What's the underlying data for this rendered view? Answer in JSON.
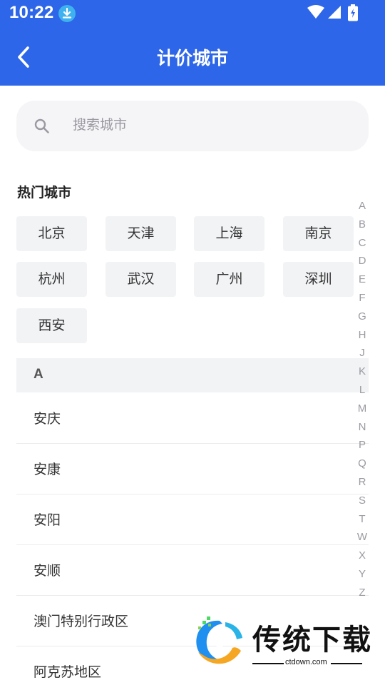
{
  "status_bar": {
    "time": "10:22",
    "icons": [
      "download-badge-icon",
      "wifi-icon",
      "cell-signal-icon",
      "battery-charging-icon"
    ]
  },
  "nav": {
    "title": "计价城市",
    "back_icon": "chevron-left-icon"
  },
  "search": {
    "placeholder": "搜索城市",
    "icon": "search-icon"
  },
  "hot_cities": {
    "title": "热门城市",
    "items": [
      "北京",
      "天津",
      "上海",
      "南京",
      "杭州",
      "武汉",
      "广州",
      "深圳",
      "西安"
    ]
  },
  "sections": [
    {
      "letter": "A",
      "cities": [
        "安庆",
        "安康",
        "安阳",
        "安顺",
        "澳门特别行政区",
        "阿克苏地区"
      ]
    }
  ],
  "alphabet_index": [
    "A",
    "B",
    "C",
    "D",
    "E",
    "F",
    "G",
    "H",
    "J",
    "K",
    "L",
    "M",
    "N",
    "P",
    "Q",
    "R",
    "S",
    "T",
    "W",
    "X",
    "Y",
    "Z"
  ],
  "watermark": {
    "text": "传统下载",
    "url": "ctdown.com"
  },
  "colors": {
    "primary": "#2d66e8",
    "chip_bg": "#f2f3f5",
    "search_bg": "#f5f5f7",
    "muted_text": "#9a9aa2"
  }
}
